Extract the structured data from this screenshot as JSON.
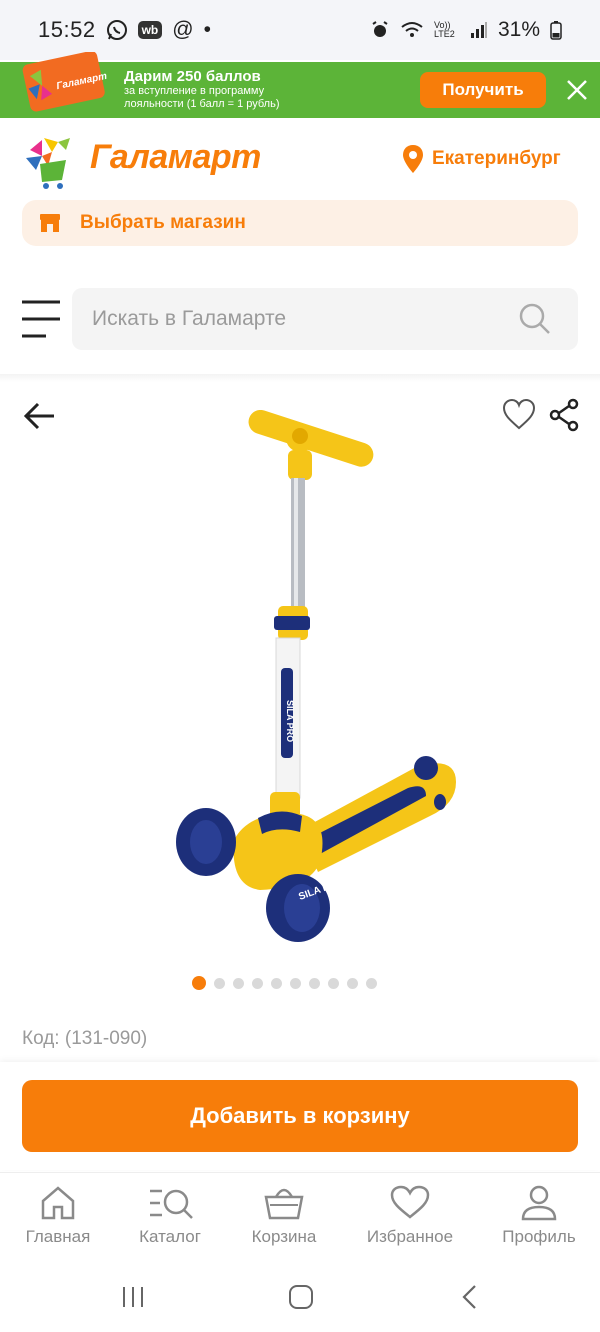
{
  "status_bar": {
    "time": "15:52",
    "notif_wb": "wb",
    "notif_at": "@",
    "notif_dot": "•",
    "network": "Vo)) LTE2",
    "battery": "31%"
  },
  "promo": {
    "title": "Дарим 250 баллов",
    "subtitle": "за вступление в программу лояльности (1 балл = 1 рубль)",
    "card_label": "Галамарт",
    "button": "Получить"
  },
  "header": {
    "logo": "Галамарт",
    "city": "Екатеринбург",
    "store_button": "Выбрать магазин"
  },
  "search": {
    "placeholder": "Искать в Галамарте"
  },
  "product": {
    "image_brand": "SILA PRO",
    "dots_total": 10,
    "dots_active": 1,
    "code": "Код: (131-090)",
    "add_to_cart": "Добавить в корзину"
  },
  "bottom_nav": [
    {
      "label": "Главная",
      "icon": "home-icon"
    },
    {
      "label": "Каталог",
      "icon": "catalog-icon"
    },
    {
      "label": "Корзина",
      "icon": "basket-icon"
    },
    {
      "label": "Избранное",
      "icon": "heart-icon"
    },
    {
      "label": "Профиль",
      "icon": "profile-icon"
    }
  ],
  "colors": {
    "accent": "#f77d0a",
    "promo_bg": "#5cb438",
    "store_bg": "#fdf0e5"
  }
}
